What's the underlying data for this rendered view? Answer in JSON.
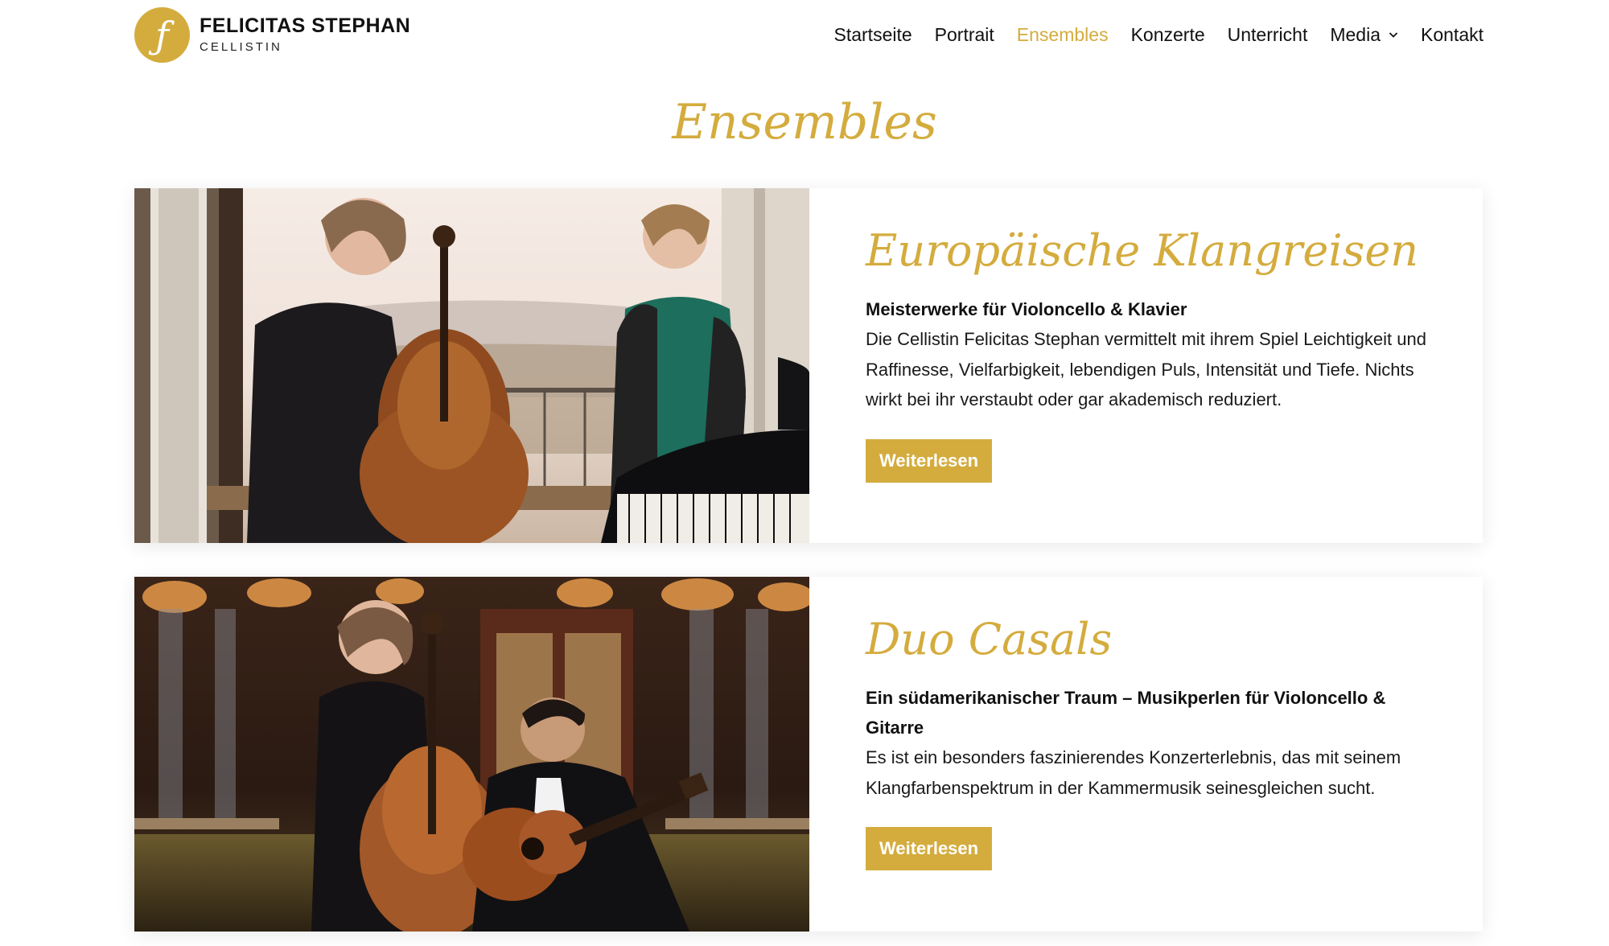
{
  "header": {
    "logo_glyph": "ƒ",
    "logo_name": "FELICITAS STEPHAN",
    "logo_subtitle": "CELLISTIN",
    "nav": [
      {
        "label": "Startseite"
      },
      {
        "label": "Portrait"
      },
      {
        "label": "Ensembles",
        "active": true
      },
      {
        "label": "Konzerte"
      },
      {
        "label": "Unterricht"
      },
      {
        "label": "Media",
        "has_dropdown": true
      },
      {
        "label": "Kontakt"
      }
    ]
  },
  "page": {
    "title": "Ensembles"
  },
  "ensembles": [
    {
      "title": "Europäische Klangreisen",
      "subtitle": "Meisterwerke für Violoncello & Klavier",
      "text": "Die Cellistin Felicitas Stephan vermittelt mit ihrem Spiel Leichtigkeit und Raffinesse, Vielfarbigkeit, lebendigen Puls, Intensität und Tiefe. Nichts wirkt bei ihr verstaubt oder gar akademisch reduziert.",
      "button": "Weiterlesen",
      "image": "photo-cellist-and-pianist"
    },
    {
      "title": "Duo Casals",
      "subtitle": "Ein südamerikanischer Traum – Musikperlen für Violoncello & Gitarre",
      "text": "Es ist ein besonders faszinierendes Konzerterlebnis, das mit seinem Klangfarbenspektrum in der Kammermusik seinesgleichen sucht.",
      "button": "Weiterlesen",
      "image": "photo-cellist-and-guitarist"
    }
  ],
  "colors": {
    "accent": "#d4ac3e",
    "text": "#111111",
    "background": "#ffffff"
  }
}
